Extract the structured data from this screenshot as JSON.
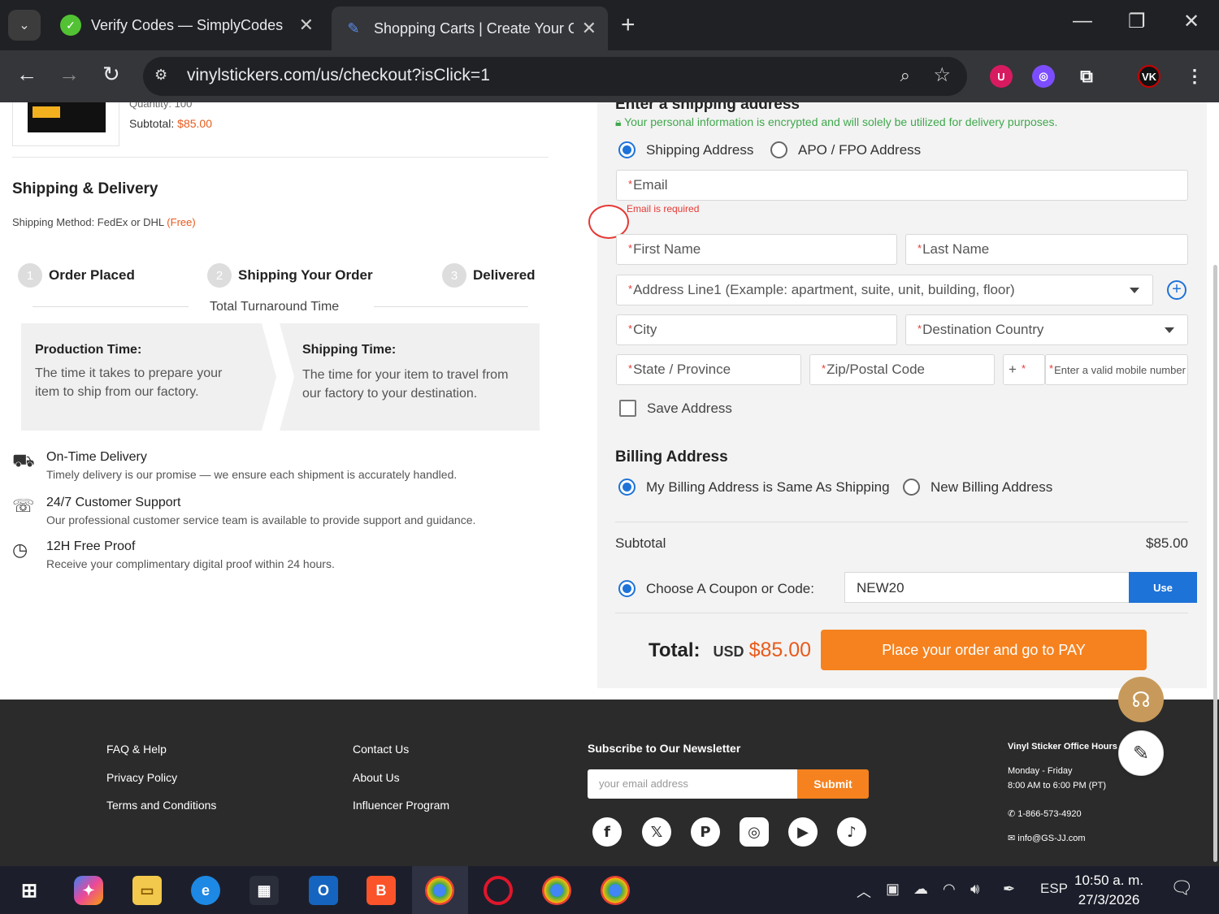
{
  "browser": {
    "tabs": [
      {
        "title": "Verify Codes — SimplyCodes",
        "favicon": "check-circle-icon",
        "active": false
      },
      {
        "title": "Shopping Carts | Create Your O",
        "favicon": "pen-icon",
        "active": true
      }
    ],
    "url": "vinylstickers.com/us/checkout?isClick=1",
    "extensions": [
      "shield-extension",
      "purple-extension",
      "puzzle-extension",
      "vk-extension"
    ]
  },
  "order_summary": {
    "quantity_label": "Quantity: 100",
    "subtotal_label": "Subtotal:",
    "subtotal_value": "$85.00"
  },
  "shipping_delivery": {
    "title": "Shipping & Delivery",
    "method_label": "Shipping Method: FedEx or DHL",
    "method_free": "(Free)",
    "steps": [
      {
        "num": "1",
        "label": "Order Placed"
      },
      {
        "num": "2",
        "label": "Shipping Your Order"
      },
      {
        "num": "3",
        "label": "Delivered"
      }
    ],
    "turnaround_label": "Total Turnaround Time",
    "production_title": "Production Time:",
    "production_text": "The time it takes to prepare your item to ship from our factory.",
    "shipping_title": "Shipping Time:",
    "shipping_text": "The time for your item to travel from our factory to your destination."
  },
  "features": [
    {
      "icon": "truck-clock-icon",
      "title": "On-Time Delivery",
      "desc": "Timely delivery is our promise — we ensure each shipment is accurately handled."
    },
    {
      "icon": "support-24-icon",
      "title": "24/7 Customer Support",
      "desc": "Our professional customer service team is available to provide support and guidance."
    },
    {
      "icon": "fast-clock-icon",
      "title": "12H Free Proof",
      "desc": "Receive your complimentary digital proof within 24 hours."
    }
  ],
  "shipping_form": {
    "title": "Enter a shipping address",
    "secure_note": "Your personal information is encrypted and will solely be utilized for delivery purposes.",
    "address_types": [
      "Shipping Address",
      "APO / FPO Address"
    ],
    "selected_address_type": "Shipping Address",
    "email_placeholder": "Email",
    "email_error": "Email is required",
    "first_name_placeholder": "First Name",
    "last_name_placeholder": "Last Name",
    "address1_placeholder": "Address Line1 (Example: apartment, suite, unit, building, floor)",
    "city_placeholder": "City",
    "country_placeholder": "Destination Country",
    "state_placeholder": "State / Province",
    "zip_placeholder": "Zip/Postal Code",
    "phone_prefix": "+",
    "phone_placeholder": "Enter a valid mobile number",
    "save_address_label": "Save Address"
  },
  "billing": {
    "title": "Billing Address",
    "options": [
      "My Billing Address is Same As Shipping",
      "New Billing Address"
    ],
    "selected": "My Billing Address is Same As Shipping"
  },
  "totals": {
    "subtotal_label": "Subtotal",
    "subtotal_value": "$85.00",
    "coupon_label": "Choose A Coupon or Code:",
    "coupon_value": "NEW20",
    "use_label": "Use",
    "total_label": "Total:",
    "currency": "USD",
    "total_value": "$85.00",
    "order_button": "Place your order and go to PAY"
  },
  "footer": {
    "col1": [
      "FAQ & Help",
      "Privacy Policy",
      "Terms and Conditions"
    ],
    "col2": [
      "Contact Us",
      "About Us",
      "Influencer Program"
    ],
    "newsletter_title": "Subscribe to Our Newsletter",
    "newsletter_placeholder": "your email address",
    "newsletter_button": "Submit",
    "social": [
      "facebook-icon",
      "x-icon",
      "pinterest-icon",
      "instagram-icon",
      "youtube-icon",
      "tiktok-icon"
    ],
    "office_title": "Vinyl Sticker Office Hours",
    "office_days": "Monday - Friday",
    "office_hours": "8:00 AM to 6:00 PM (PT)",
    "phone": "1-866-573-4920",
    "email": "info@GS-JJ.com"
  },
  "taskbar": {
    "language": "ESP",
    "time": "10:50 a. m.",
    "date": "27/3/2026"
  },
  "colors": {
    "accent_orange": "#f5821f",
    "price_orange": "#e85a1b",
    "link_blue": "#1e73d8",
    "secure_green": "#3fa84c",
    "error_red": "#e53935"
  }
}
